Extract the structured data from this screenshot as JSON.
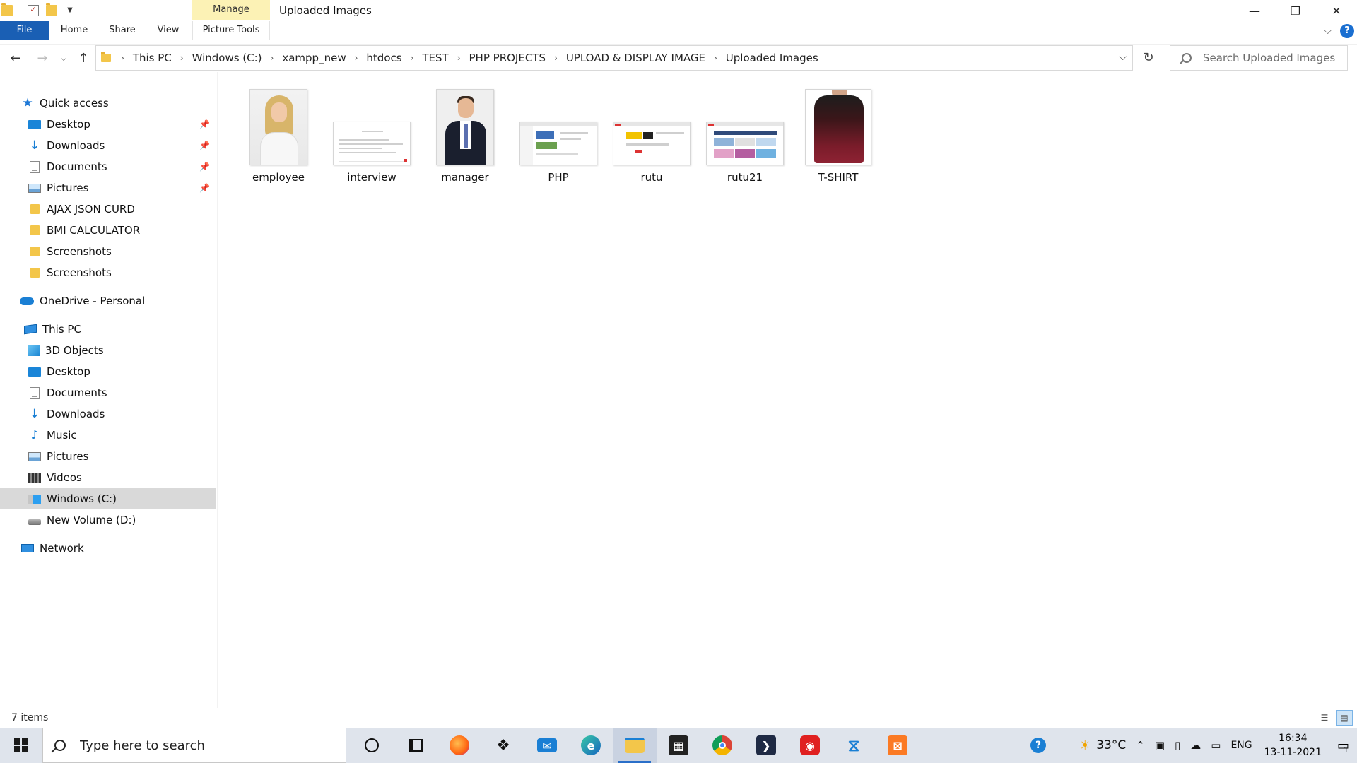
{
  "window": {
    "title": "Uploaded Images",
    "contextual_tab_group": "Manage",
    "caption_buttons": {
      "minimize": "—",
      "maximize": "❐",
      "close": "✕"
    }
  },
  "ribbon": {
    "tabs": [
      "File",
      "Home",
      "Share",
      "View",
      "Picture Tools"
    ]
  },
  "address": {
    "crumbs": [
      "This PC",
      "Windows (C:)",
      "xampp_new",
      "htdocs",
      "TEST",
      "PHP PROJECTS",
      "UPLOAD & DISPLAY IMAGE",
      "Uploaded Images"
    ]
  },
  "search": {
    "placeholder": "Search Uploaded Images"
  },
  "nav_pane": {
    "quick_access": "Quick access",
    "quick_items": [
      "Desktop",
      "Downloads",
      "Documents",
      "Pictures",
      "AJAX JSON CURD",
      "BMI CALCULATOR",
      "Screenshots",
      "Screenshots"
    ],
    "onedrive": "OneDrive - Personal",
    "this_pc": "This PC",
    "pc_items": [
      "3D Objects",
      "Desktop",
      "Documents",
      "Downloads",
      "Music",
      "Pictures",
      "Videos",
      "Windows (C:)",
      "New Volume (D:)"
    ],
    "network": "Network"
  },
  "files": [
    "employee",
    "interview",
    "manager",
    "PHP",
    "rutu",
    "rutu21",
    "T-SHIRT"
  ],
  "status": {
    "item_count": "7 items"
  },
  "taskbar": {
    "search_placeholder": "Type here to search",
    "weather": "33°C",
    "language": "ENG",
    "time": "16:34",
    "date": "13-11-2021",
    "notification_count": "1"
  }
}
